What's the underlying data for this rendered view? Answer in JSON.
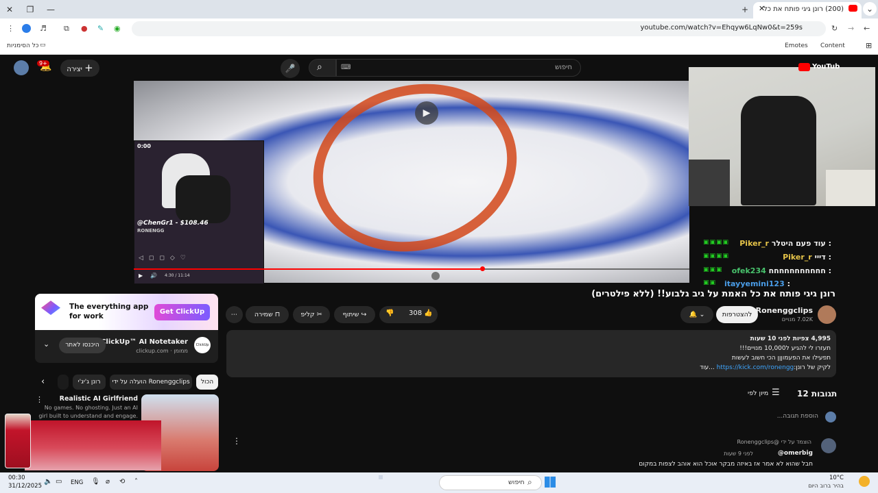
{
  "browser": {
    "tab_title": "(200) רונן גיגי פותח את כל",
    "url": "youtube.com/watch?v=Ehqyw6LqNw0&t=259s",
    "bookmarks": {
      "all_bookmarks": "כל הסימניות",
      "content": "Content",
      "emotes": "Emotes"
    }
  },
  "youtube_header": {
    "search_placeholder": "חיפוש",
    "create_label": "יצירה",
    "notifications_badge": "9+",
    "logo_text": "YouTube"
  },
  "video": {
    "pip_overlay_text": "@ChenGr1 - $108.46",
    "pip_brand": "RONENGG",
    "pip_topbar": "0:00",
    "time_display": "4:30 / 11:14",
    "title": "רונן גיגי פותח את כל האמת על גיב גלבוע!! (ללא פילטרים)",
    "progress": 0.625
  },
  "chat": [
    {
      "user": "Piker_r",
      "message": "עוד פעם היטלר :",
      "color": "#e6c449"
    },
    {
      "user": "Piker_r",
      "message": "דייי :",
      "color": "#e6c449"
    },
    {
      "user": "ofek234",
      "message": "חחחחחחחחחחח :",
      "color": "#48c26c"
    },
    {
      "user": "itayyemini123",
      "message": ":",
      "color": "#4a9de8"
    }
  ],
  "channel": {
    "name": "Ronenggclips",
    "subscribers": "7.02K מנויים",
    "subscribe_label": "להצטרפות"
  },
  "actions": {
    "likes": "308",
    "share": "שיתוף",
    "clip": "קליפ",
    "save": "שמירה"
  },
  "description": {
    "views": "4,995 צפיות  לפני 10 שעות",
    "line1": "תעזרו לי להגיע ל10,000 מנויים!!!",
    "line2": "תפעילו את הפעמוןןן הכי חשוב לעשות",
    "link": "https://kick.com/ronengg",
    "line3_prefix": "לקיק של רונן:",
    "more": "...עוד"
  },
  "ad": {
    "headline_1": "The everything app",
    "headline_2": "for work",
    "cta": "Get ClickUp",
    "advertiser": "ClickUp™ AI Notetaker",
    "meta": "clickup.com · ממומן",
    "visit": "היכנסו לאתר",
    "logo_text": "ClickUp"
  },
  "chips": [
    "הכול",
    "הועלה על ידי Ronenggclips",
    "רונן ג'יג'י"
  ],
  "recommendation": {
    "title": "Realistic AI Girlfriend",
    "desc_1": "No games. No ghosting. Just an AI",
    "desc_2": "girl built to understand and engage."
  },
  "comments": {
    "count": "12 תגובות",
    "sort": "מיון לפי",
    "add_placeholder": "הוספת תגובה...",
    "pinned": "הוצמד על ידי @Ronenggclips",
    "first_author": "@omerbig",
    "first_time": "לפני 9 שעות",
    "first_text": "חבל שהוא לא אמר אז באיזה מבקר אוכל הוא אוהב לצפות במקום"
  },
  "taskbar": {
    "search": "חיפוש",
    "time": "00:30",
    "date": "31/12/2025",
    "lang": "ENG",
    "weather_temp": "10°C",
    "weather_desc": "בהיר ברוב היום"
  }
}
